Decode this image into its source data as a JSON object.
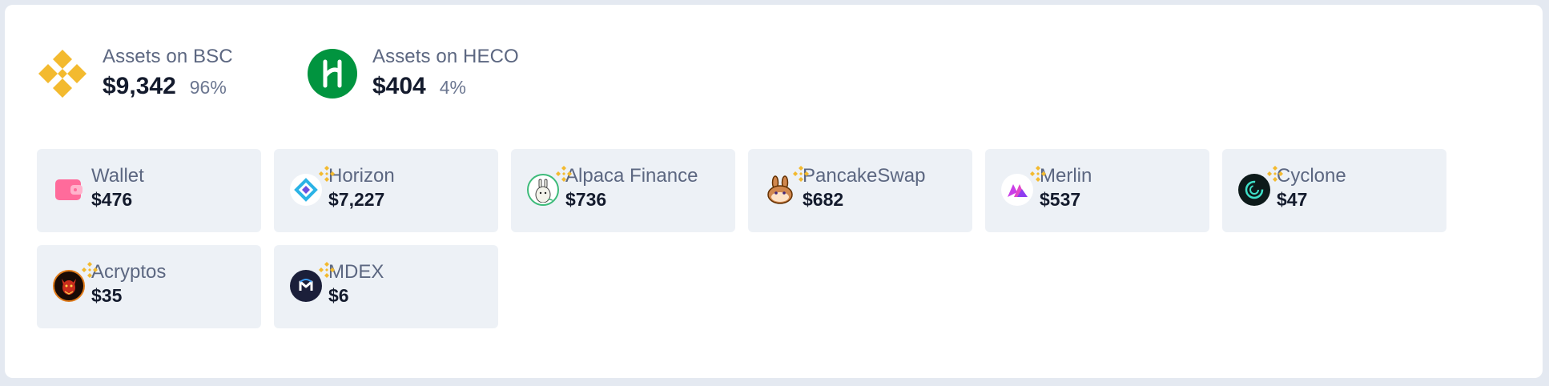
{
  "chains": [
    {
      "title": "Assets on BSC",
      "amount": "$9,342",
      "percent": "96%",
      "icon": "binance-icon",
      "color": "#f3ba2f"
    },
    {
      "title": "Assets on HECO",
      "amount": "$404",
      "percent": "4%",
      "icon": "heco-icon",
      "color": "#01943f"
    }
  ],
  "cards": [
    {
      "name": "Wallet",
      "value": "$476",
      "icon": "wallet-icon",
      "badge": false
    },
    {
      "name": "Horizon",
      "value": "$7,227",
      "icon": "horizon-icon",
      "badge": true
    },
    {
      "name": "Alpaca Finance",
      "value": "$736",
      "icon": "alpaca-icon",
      "badge": true
    },
    {
      "name": "PancakeSwap",
      "value": "$682",
      "icon": "pancakeswap-icon",
      "badge": true
    },
    {
      "name": "Merlin",
      "value": "$537",
      "icon": "merlin-icon",
      "badge": true
    },
    {
      "name": "Cyclone",
      "value": "$47",
      "icon": "cyclone-icon",
      "badge": true
    },
    {
      "name": "Acryptos",
      "value": "$35",
      "icon": "acryptos-icon",
      "badge": true
    },
    {
      "name": "MDEX",
      "value": "$6",
      "icon": "mdex-icon",
      "badge": true
    }
  ],
  "colors": {
    "binance": "#f3ba2f",
    "heco": "#01943f",
    "card_bg": "#edf1f6",
    "muted_text": "#5c6781",
    "value_text": "#141b2d"
  }
}
